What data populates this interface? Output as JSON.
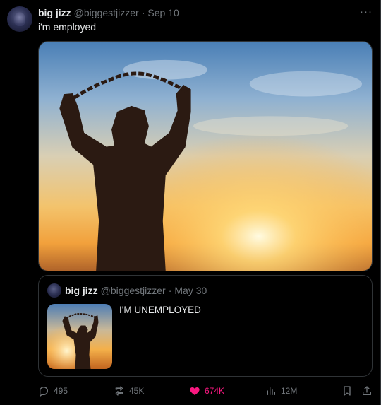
{
  "tweet": {
    "display_name": "big jizz",
    "handle": "@biggestjizzer",
    "separator": "·",
    "date": "Sep 10",
    "text": "i'm employed",
    "more_label": "···"
  },
  "quoted": {
    "display_name": "big jizz",
    "handle": "@biggestjizzer",
    "separator": "·",
    "date": "May 30",
    "text": "I'M UNEMPLOYED"
  },
  "actions": {
    "replies": "495",
    "reposts": "45K",
    "likes": "674K",
    "views": "12M"
  },
  "colors": {
    "background": "#000000",
    "text": "#e7e9ea",
    "muted": "#71767b",
    "like": "#f91880",
    "border": "#2f3336"
  },
  "icons": {
    "reply": "reply-icon",
    "repost": "repost-icon",
    "like": "heart-icon",
    "views": "views-icon",
    "bookmark": "bookmark-icon",
    "share": "share-icon",
    "more": "more-icon"
  }
}
